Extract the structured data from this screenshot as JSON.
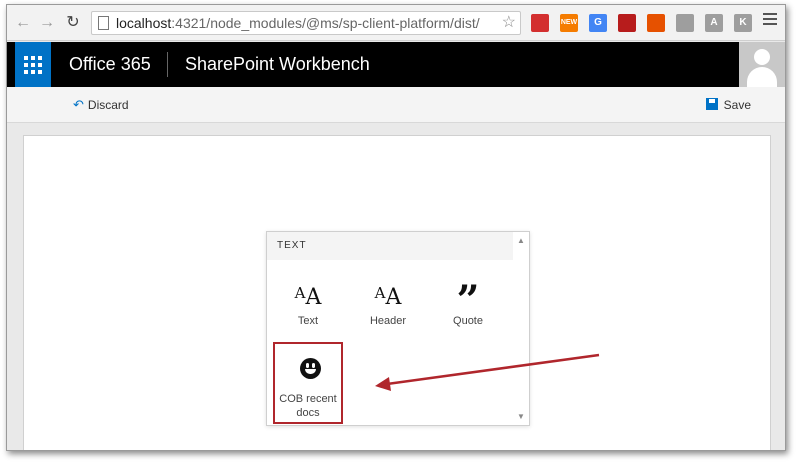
{
  "browser": {
    "url_host": "localhost",
    "url_path": ":4321/node_modules/@ms/sp-client-platform/dist/​",
    "extensions": [
      {
        "name": "red-extension-icon",
        "color": "#d32f2f",
        "text": ""
      },
      {
        "name": "new-extension-icon",
        "color": "#f57c00",
        "text": "NEW"
      },
      {
        "name": "translate-extension-icon",
        "color": "#4285f4",
        "text": "G"
      },
      {
        "name": "couch-extension-icon",
        "color": "#b71c1c",
        "text": ""
      },
      {
        "name": "office-extension-icon",
        "color": "#e65100",
        "text": ""
      },
      {
        "name": "reader-extension-icon",
        "color": "#9e9e9e",
        "text": ""
      },
      {
        "name": "a-extension-icon",
        "color": "#9e9e9e",
        "text": "A"
      },
      {
        "name": "k-extension-icon",
        "color": "#9e9e9e",
        "text": "K"
      }
    ]
  },
  "suite": {
    "brand": "Office 365",
    "app_name": "SharePoint Workbench"
  },
  "commands": {
    "discard_label": "Discard",
    "save_label": "Save"
  },
  "toolbox": {
    "section_title": "TEXT",
    "items": [
      {
        "label": "Text"
      },
      {
        "label": "Header"
      },
      {
        "label": "Quote"
      },
      {
        "label": "COB recent docs"
      }
    ]
  },
  "colors": {
    "accent": "#0072c6",
    "highlight": "#b0262c"
  }
}
